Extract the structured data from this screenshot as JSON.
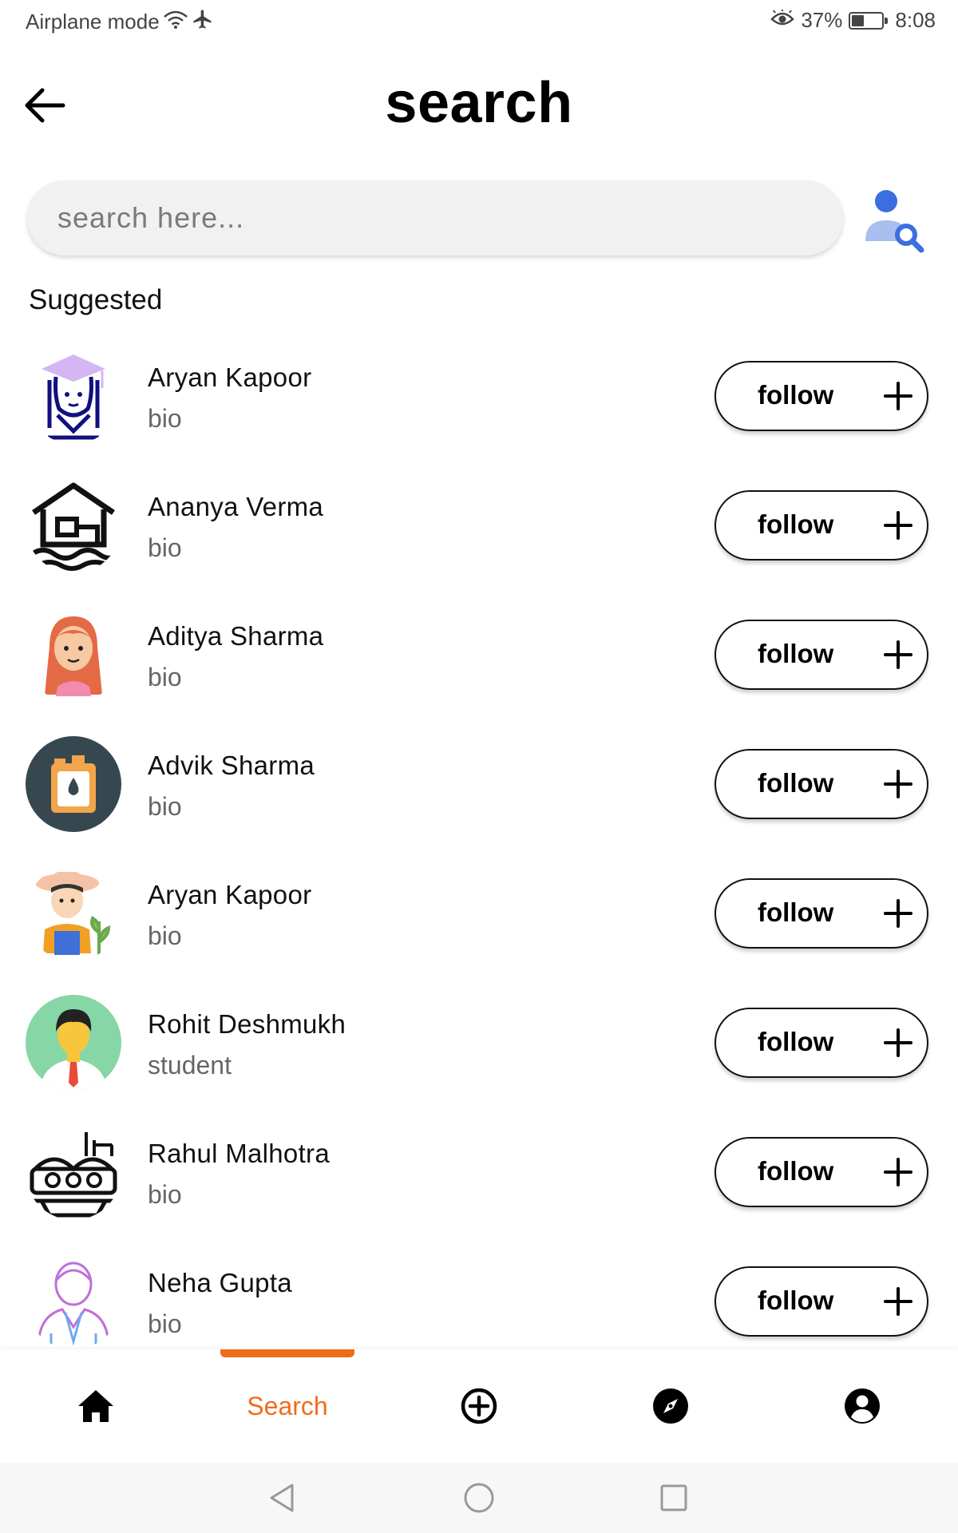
{
  "status_bar": {
    "left_text": "Airplane mode",
    "battery_percent": "37%",
    "battery_level": 0.37,
    "time": "8:08",
    "icons": [
      "wifi-icon",
      "airplane-icon",
      "eye-comfort-icon",
      "battery-icon"
    ]
  },
  "header": {
    "title": "search",
    "back_icon": "arrow-left-icon"
  },
  "search": {
    "placeholder": "search here...",
    "value": "",
    "user_search_icon": "user-search-icon"
  },
  "section": {
    "title": "Suggested"
  },
  "users": [
    {
      "name": "Aryan Kapoor",
      "bio": "bio",
      "follow_label": "follow",
      "avatar": "graduate-avatar"
    },
    {
      "name": "Ananya Verma",
      "bio": "bio",
      "follow_label": "follow",
      "avatar": "house-waves-avatar"
    },
    {
      "name": "Aditya Sharma",
      "bio": "bio",
      "follow_label": "follow",
      "avatar": "red-hair-girl-avatar"
    },
    {
      "name": "Advik Sharma",
      "bio": "bio",
      "follow_label": "follow",
      "avatar": "oil-can-avatar"
    },
    {
      "name": "Aryan Kapoor",
      "bio": "bio",
      "follow_label": "follow",
      "avatar": "farmer-avatar"
    },
    {
      "name": "Rohit Deshmukh",
      "bio": "student",
      "follow_label": "follow",
      "avatar": "man-tie-avatar"
    },
    {
      "name": "Rahul Malhotra",
      "bio": "bio",
      "follow_label": "follow",
      "avatar": "factory-avatar"
    },
    {
      "name": "Neha Gupta",
      "bio": "bio",
      "follow_label": "follow",
      "avatar": "outline-person-avatar"
    }
  ],
  "bottom_nav": {
    "items": [
      {
        "id": "home",
        "icon": "home-icon"
      },
      {
        "id": "search",
        "label": "Search",
        "active": true
      },
      {
        "id": "add",
        "icon": "add-circle-icon"
      },
      {
        "id": "explore",
        "icon": "compass-icon"
      },
      {
        "id": "profile",
        "icon": "profile-icon"
      }
    ],
    "active_color": "#ef6c1b"
  },
  "system_nav": {
    "icons": [
      "back-triangle-icon",
      "home-circle-icon",
      "recents-square-icon"
    ]
  },
  "colors": {
    "accent": "#ef6c1b",
    "user_search_blue": "#3b6fe0",
    "user_search_light": "#a9bff0"
  }
}
